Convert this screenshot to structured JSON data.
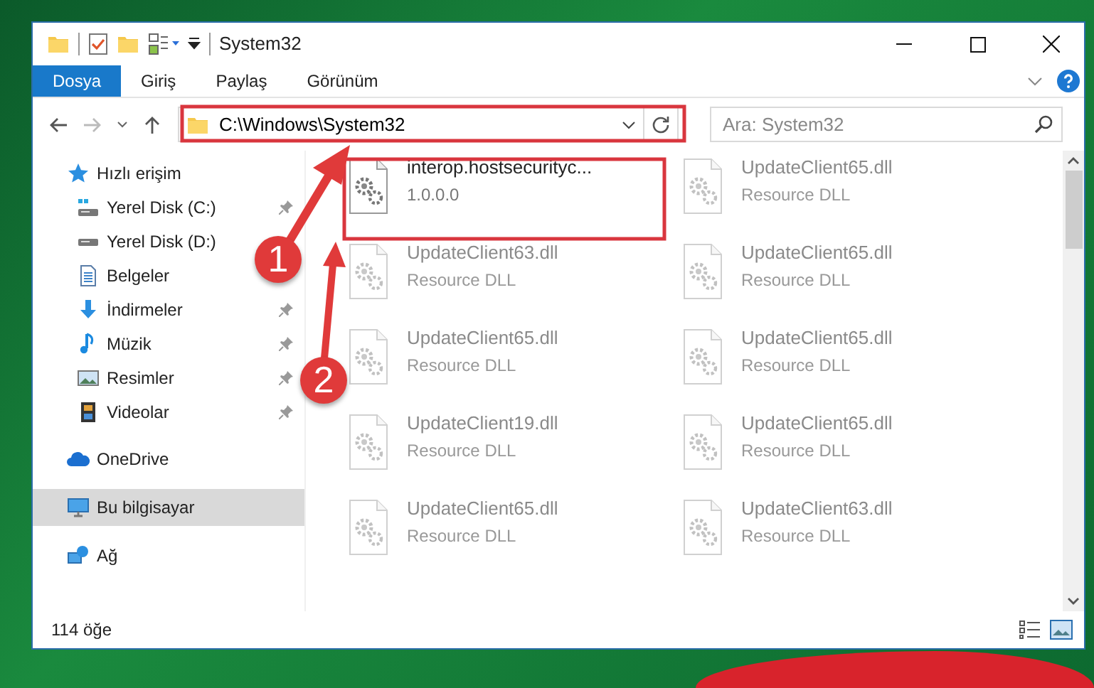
{
  "window": {
    "title": "System32"
  },
  "ribbon_tabs": [
    {
      "label": "Dosya",
      "selected": true
    },
    {
      "label": "Giriş",
      "selected": false
    },
    {
      "label": "Paylaş",
      "selected": false
    },
    {
      "label": "Görünüm",
      "selected": false
    }
  ],
  "address_bar": {
    "value": "C:\\Windows\\System32"
  },
  "search": {
    "placeholder": "Ara: System32"
  },
  "sidebar": {
    "items": [
      {
        "label": "Hızlı erişim",
        "selected": false,
        "children": [
          {
            "label": "Yerel Disk (C:)",
            "selected": false,
            "pinned": true
          },
          {
            "label": "Yerel Disk (D:)",
            "selected": false,
            "pinned": false
          },
          {
            "label": "Belgeler",
            "selected": false,
            "pinned": false
          },
          {
            "label": "İndirmeler",
            "selected": false,
            "pinned": true
          },
          {
            "label": "Müzik",
            "selected": false,
            "pinned": true
          },
          {
            "label": "Resimler",
            "selected": false,
            "pinned": true
          },
          {
            "label": "Videolar",
            "selected": false,
            "pinned": true
          }
        ]
      },
      {
        "label": "OneDrive",
        "selected": false
      },
      {
        "label": "Bu bilgisayar",
        "selected": true
      },
      {
        "label": "Ağ",
        "selected": false
      }
    ]
  },
  "files": [
    {
      "name": "interop.hostsecurityc...",
      "detail": "1.0.0.0",
      "faded": false
    },
    {
      "name": "UpdateClient65.dll",
      "detail": "Resource DLL",
      "faded": true
    },
    {
      "name": "UpdateClient63.dll",
      "detail": "Resource DLL",
      "faded": true
    },
    {
      "name": "UpdateClient65.dll",
      "detail": "Resource DLL",
      "faded": true
    },
    {
      "name": "UpdateClient65.dll",
      "detail": "Resource DLL",
      "faded": true
    },
    {
      "name": "UpdateClient65.dll",
      "detail": "Resource DLL",
      "faded": true
    },
    {
      "name": "UpdateClient19.dll",
      "detail": "Resource DLL",
      "faded": true
    },
    {
      "name": "UpdateClient65.dll",
      "detail": "Resource DLL",
      "faded": true
    },
    {
      "name": "UpdateClient65.dll",
      "detail": "Resource DLL",
      "faded": true
    },
    {
      "name": "UpdateClient63.dll",
      "detail": "Resource DLL",
      "faded": true
    }
  ],
  "status_bar": {
    "item_count": "114 öğe"
  },
  "annotations": {
    "markers": [
      {
        "label": "1"
      },
      {
        "label": "2"
      }
    ]
  }
}
